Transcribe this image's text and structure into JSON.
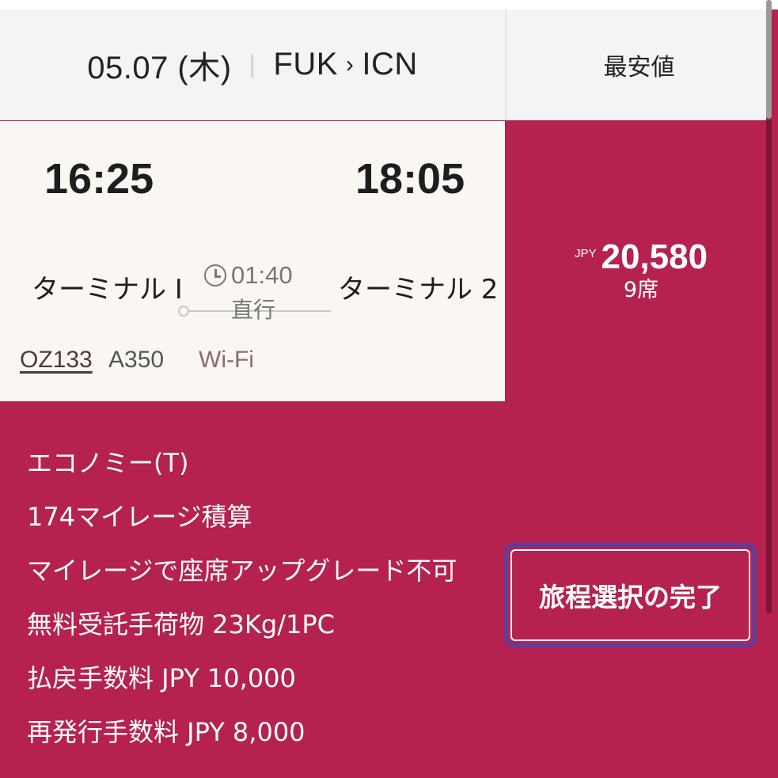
{
  "header": {
    "date": "05.07 (木)",
    "origin": "FUK",
    "destination": "ICN",
    "sort_label": "最安値"
  },
  "flight": {
    "departure_time": "16:25",
    "arrival_time": "18:05",
    "departure_terminal": "ターミナル I",
    "arrival_terminal": "ターミナル 2",
    "duration": "01:40",
    "stops": "直行",
    "flight_number": "OZ133",
    "aircraft": "A350",
    "amenity": "Wi-Fi"
  },
  "fare": {
    "currency": "JPY",
    "amount": "20,580",
    "seats": "9席"
  },
  "details": [
    "エコノミー(T)",
    "174マイレージ積算",
    "マイレージで座席アップグレード不可",
    "無料受託手荷物 23Kg/1PC",
    "払戻手数料 JPY 10,000",
    "再発行手数料 JPY 8,000"
  ],
  "actions": {
    "complete_label": "旅程選択の完了"
  },
  "colors": {
    "accent": "#b5224f",
    "focus_ring": "#5b3fa0",
    "card_bg": "#faf6f1",
    "header_bg": "#f4f4f4"
  }
}
